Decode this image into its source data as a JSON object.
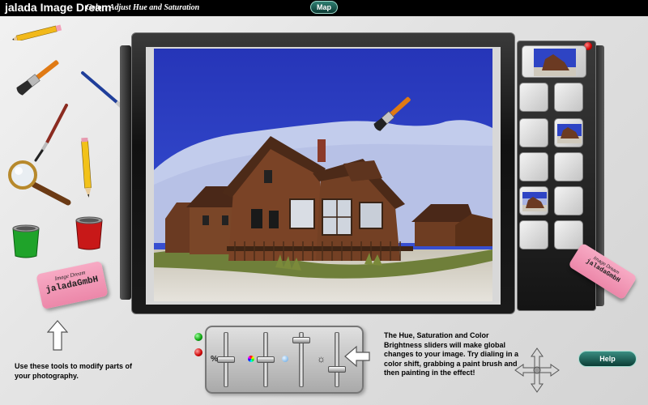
{
  "topbar": {
    "app_title": "jalada Image Dream",
    "module_title": "Color: Adjust Hue and Saturation",
    "map_label": "Map"
  },
  "tools": {
    "eraser_left_brand": "Image Dream",
    "eraser_left_maker": "jaladaGmbH",
    "eraser_right_brand": "Image Dream",
    "eraser_right_maker": "jaladaGmbH",
    "help_text": "Use these tools to modify parts of your photography."
  },
  "sliders": {
    "saturation_symbol": "%",
    "brightness_symbol": "☼",
    "values": {
      "saturation": 0.5,
      "hue": 0.5,
      "color_brightness": 0.9,
      "brightness": 0.3
    },
    "help_text": "The Hue, Saturation and Color Brightness sliders will make global changes to your image. Try dialing in a color shift, grabbing a paint brush and then painting in the effect!"
  },
  "help_label": "Help",
  "colors": {
    "sky": "#2c3fbf",
    "accent_teal": "#1b5f56",
    "eraser_pink": "#f29bb8",
    "led_green": "#19c219",
    "led_red": "#d11a1a"
  },
  "icons": {
    "tools": [
      "pencil-icon",
      "paintbrush-icon",
      "fine-brush-icon",
      "thin-brush-icon",
      "magnifier-icon",
      "green-bucket-icon",
      "red-bucket-icon",
      "eraser-icon"
    ],
    "navigation": [
      "up-arrow-icon",
      "pointer-arrow-icon",
      "move-arrows-icon"
    ]
  }
}
